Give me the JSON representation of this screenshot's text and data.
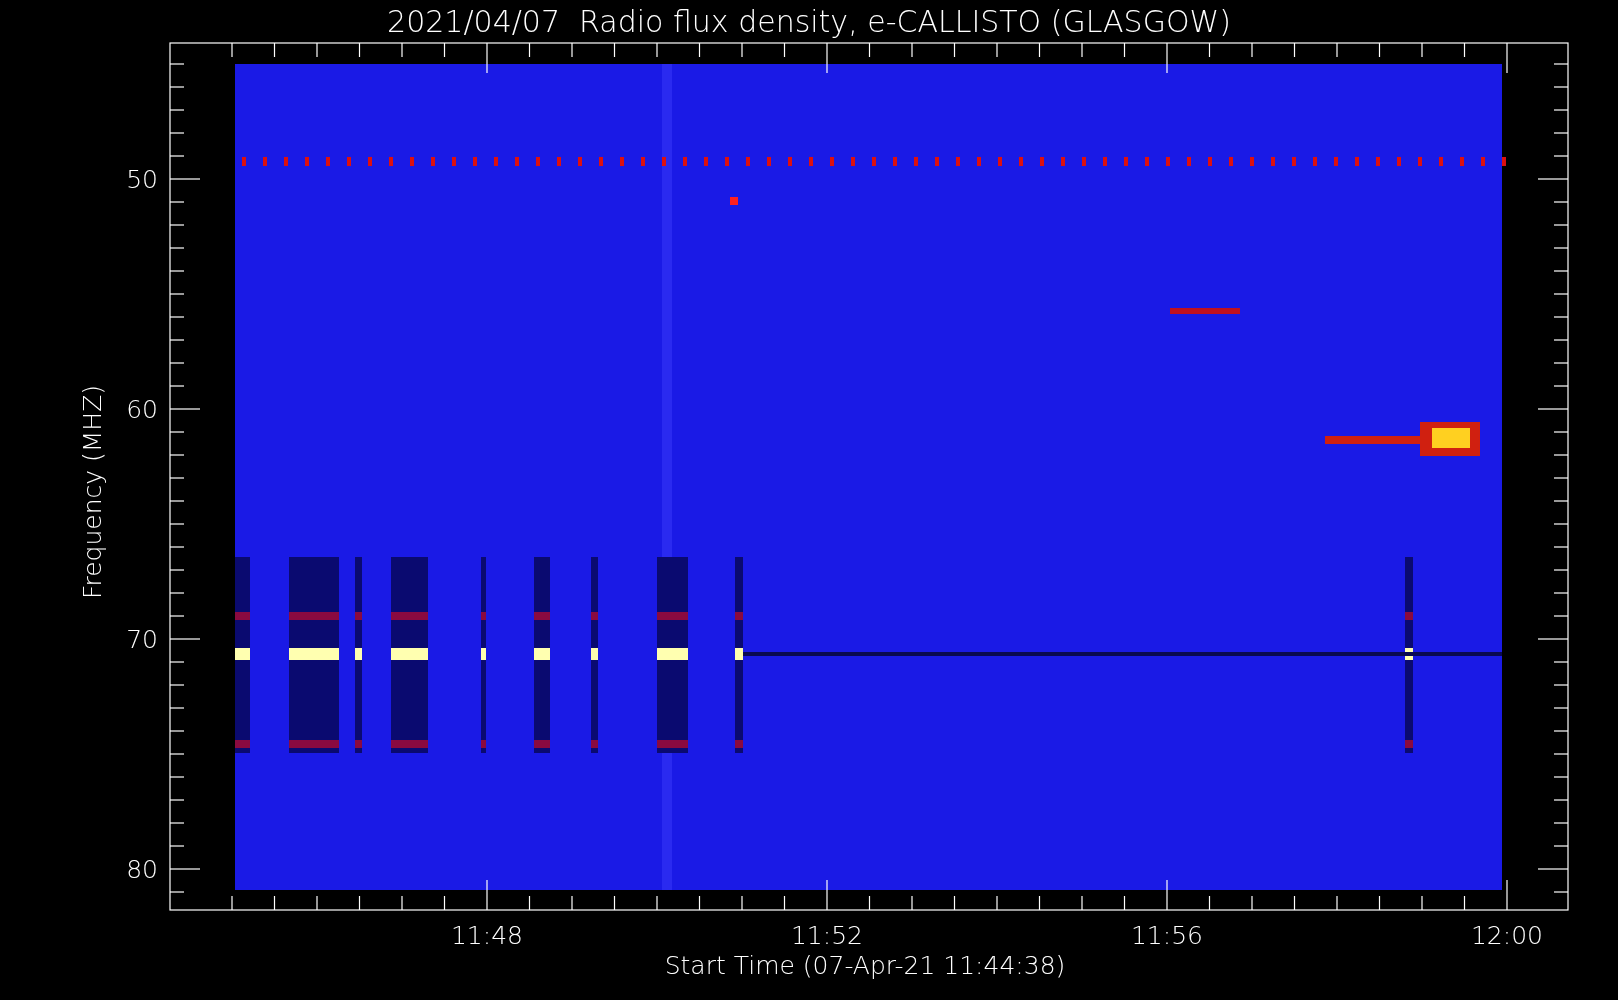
{
  "title": "2021/04/07  Radio flux density, e-CALLISTO (GLASGOW)",
  "ylabel": "Frequency (MHZ)",
  "xlabel": "Start Time (07-Apr-21 11:44:38)",
  "yticks": [
    "50",
    "60",
    "70",
    "80"
  ],
  "xticks": [
    "11:48",
    "11:52",
    "11:56",
    "12:00"
  ]
}
